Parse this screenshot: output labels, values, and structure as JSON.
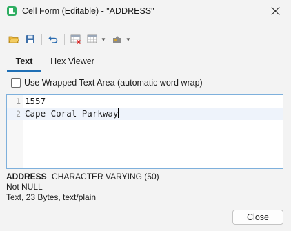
{
  "window": {
    "title": "Cell Form (Editable) - \"ADDRESS\""
  },
  "toolbar": {
    "icons": [
      "folder-open-icon",
      "save-icon",
      "undo-icon",
      "grid-delete-icon",
      "grid-icon",
      "puzzle-icon"
    ]
  },
  "tabs": [
    {
      "label": "Text",
      "active": true
    },
    {
      "label": "Hex Viewer",
      "active": false
    }
  ],
  "wrap_option": {
    "label": "Use Wrapped Text Area (automatic word wrap)",
    "checked": false
  },
  "editor": {
    "lines": [
      {
        "number": "1",
        "text": "1557"
      },
      {
        "number": "2",
        "text": "Cape Coral Parkway"
      }
    ]
  },
  "column_info": {
    "name": "ADDRESS",
    "type": "CHARACTER VARYING (50)",
    "nullability": "Not NULL",
    "content_info": "Text, 23 Bytes, text/plain"
  },
  "buttons": {
    "close_label": "Close"
  },
  "colors": {
    "accent": "#1f6fb5",
    "app_icon": "#2fae62",
    "editor_border": "#7eb0dc"
  }
}
